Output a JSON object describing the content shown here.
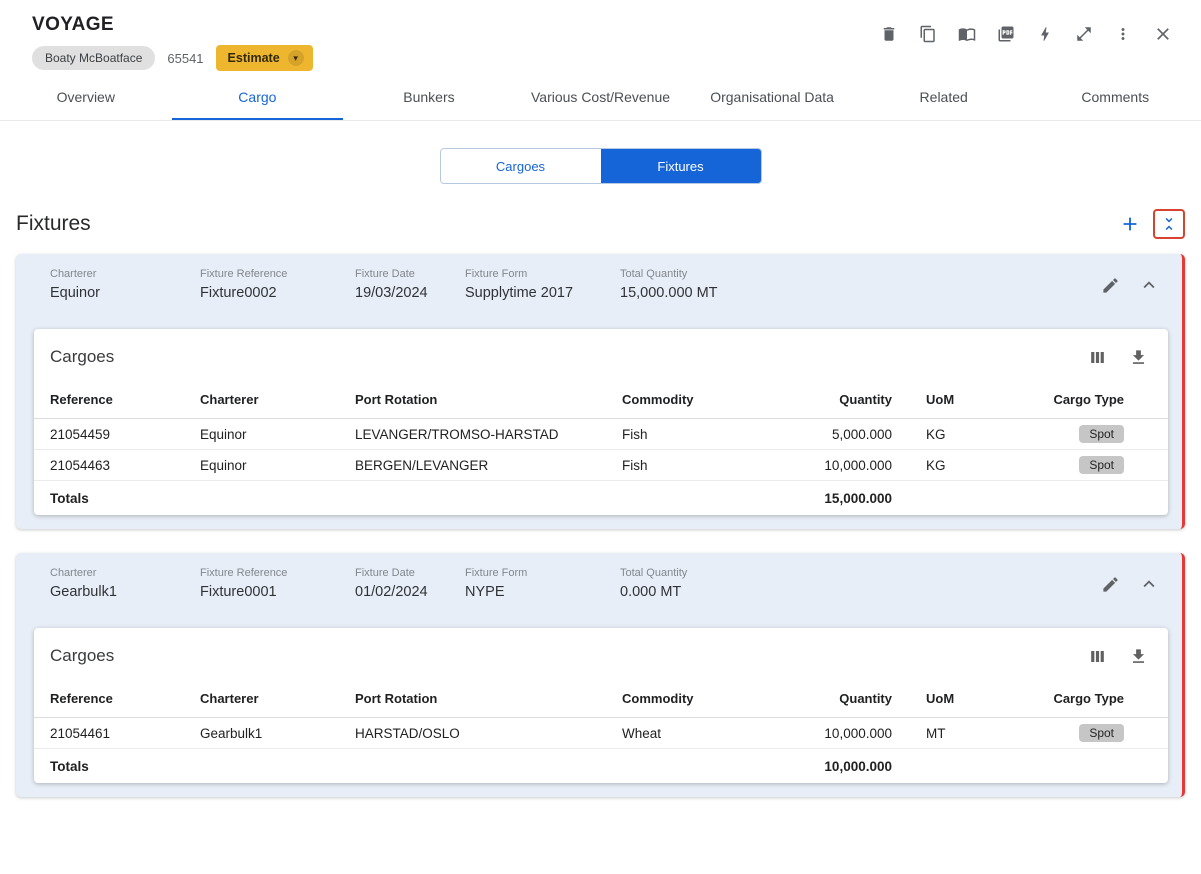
{
  "accent_color": "#1665d8",
  "estimate_color": "#eeb62f",
  "attention_color": "#e53935",
  "header": {
    "title": "VOYAGE",
    "vessel_chip": "Boaty McBoatface",
    "voyage_number": "65541",
    "estimate_label": "Estimate",
    "caret_glyph": "▾"
  },
  "tabs": [
    {
      "label": "Overview"
    },
    {
      "label": "Cargo"
    },
    {
      "label": "Bunkers"
    },
    {
      "label": "Various Cost/Revenue"
    },
    {
      "label": "Organisational Data"
    },
    {
      "label": "Related"
    },
    {
      "label": "Comments"
    }
  ],
  "active_tab": "Cargo",
  "view_toggle": {
    "cargoes_label": "Cargoes",
    "fixtures_label": "Fixtures",
    "selected": "Fixtures"
  },
  "section": {
    "title": "Fixtures"
  },
  "table_columns": [
    "Reference",
    "Charterer",
    "Port Rotation",
    "Commodity",
    "Quantity",
    "UoM",
    "Cargo Type"
  ],
  "fixtures": [
    {
      "charterer": {
        "label": "Charterer",
        "value": "Equinor"
      },
      "fixture_reference": {
        "label": "Fixture Reference",
        "value": "Fixture0002"
      },
      "fixture_date": {
        "label": "Fixture Date",
        "value": "19/03/2024"
      },
      "fixture_form": {
        "label": "Fixture Form",
        "value": "Supplytime 2017"
      },
      "total_quantity": {
        "label": "Total Quantity",
        "value": "15,000.000 MT"
      },
      "cargoes": {
        "title": "Cargoes",
        "rows": [
          {
            "reference": "21054459",
            "charterer": "Equinor",
            "port_rotation": "LEVANGER/TROMSO-HARSTAD",
            "commodity": "Fish",
            "quantity": "5,000.000",
            "uom": "KG",
            "cargo_type": "Spot"
          },
          {
            "reference": "21054463",
            "charterer": "Equinor",
            "port_rotation": "BERGEN/LEVANGER",
            "commodity": "Fish",
            "quantity": "10,000.000",
            "uom": "KG",
            "cargo_type": "Spot"
          }
        ],
        "totals_label": "Totals",
        "total_quantity": "15,000.000"
      }
    },
    {
      "charterer": {
        "label": "Charterer",
        "value": "Gearbulk1"
      },
      "fixture_reference": {
        "label": "Fixture Reference",
        "value": "Fixture0001"
      },
      "fixture_date": {
        "label": "Fixture Date",
        "value": "01/02/2024"
      },
      "fixture_form": {
        "label": "Fixture Form",
        "value": "NYPE"
      },
      "total_quantity": {
        "label": "Total Quantity",
        "value": "0.000 MT"
      },
      "cargoes": {
        "title": "Cargoes",
        "rows": [
          {
            "reference": "21054461",
            "charterer": "Gearbulk1",
            "port_rotation": "HARSTAD/OSLO",
            "commodity": "Wheat",
            "quantity": "10,000.000",
            "uom": "MT",
            "cargo_type": "Spot"
          }
        ],
        "totals_label": "Totals",
        "total_quantity": "10,000.000"
      }
    }
  ]
}
